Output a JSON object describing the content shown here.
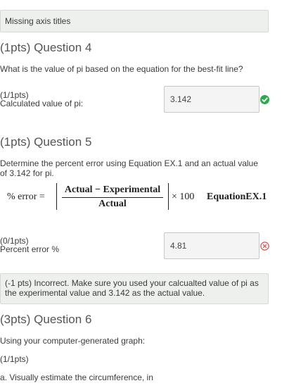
{
  "top_feedback": "Missing axis titles",
  "q4": {
    "title": "(1pts) Question 4",
    "text": "What is the value of pi based on the equation for the best-fit line?",
    "pts": "(1/1pts)",
    "label": "Calculated value of pi:",
    "value": "3.142",
    "status_icon": "check-circle-icon",
    "status_color": "#2fa84f"
  },
  "q5": {
    "title": "(1pts) Question 5",
    "text": "Determine the percent error using Equation EX.1 and an actual value of 3.142 for pi.",
    "equation": {
      "lhs": "% error =",
      "numerator": "Actual − Experimental",
      "denominator": "Actual",
      "rhs": "× 100",
      "name": "EquationEX.1"
    },
    "pts": "(0/1pts)",
    "label": "Percent error %",
    "value": "4.81",
    "status_icon": "error-circle-icon",
    "status_color": "#d9534f",
    "feedback": "(-1 pts) Incorrect. Make sure you used your calcualted value of pi as the experimental value and 3.142 as the actual value."
  },
  "q6": {
    "title": "(3pts) Question 6",
    "text": "Using your computer-generated graph:",
    "pts": "(1/1pts)",
    "partial": "a. Visually estimate the circumference, in"
  }
}
